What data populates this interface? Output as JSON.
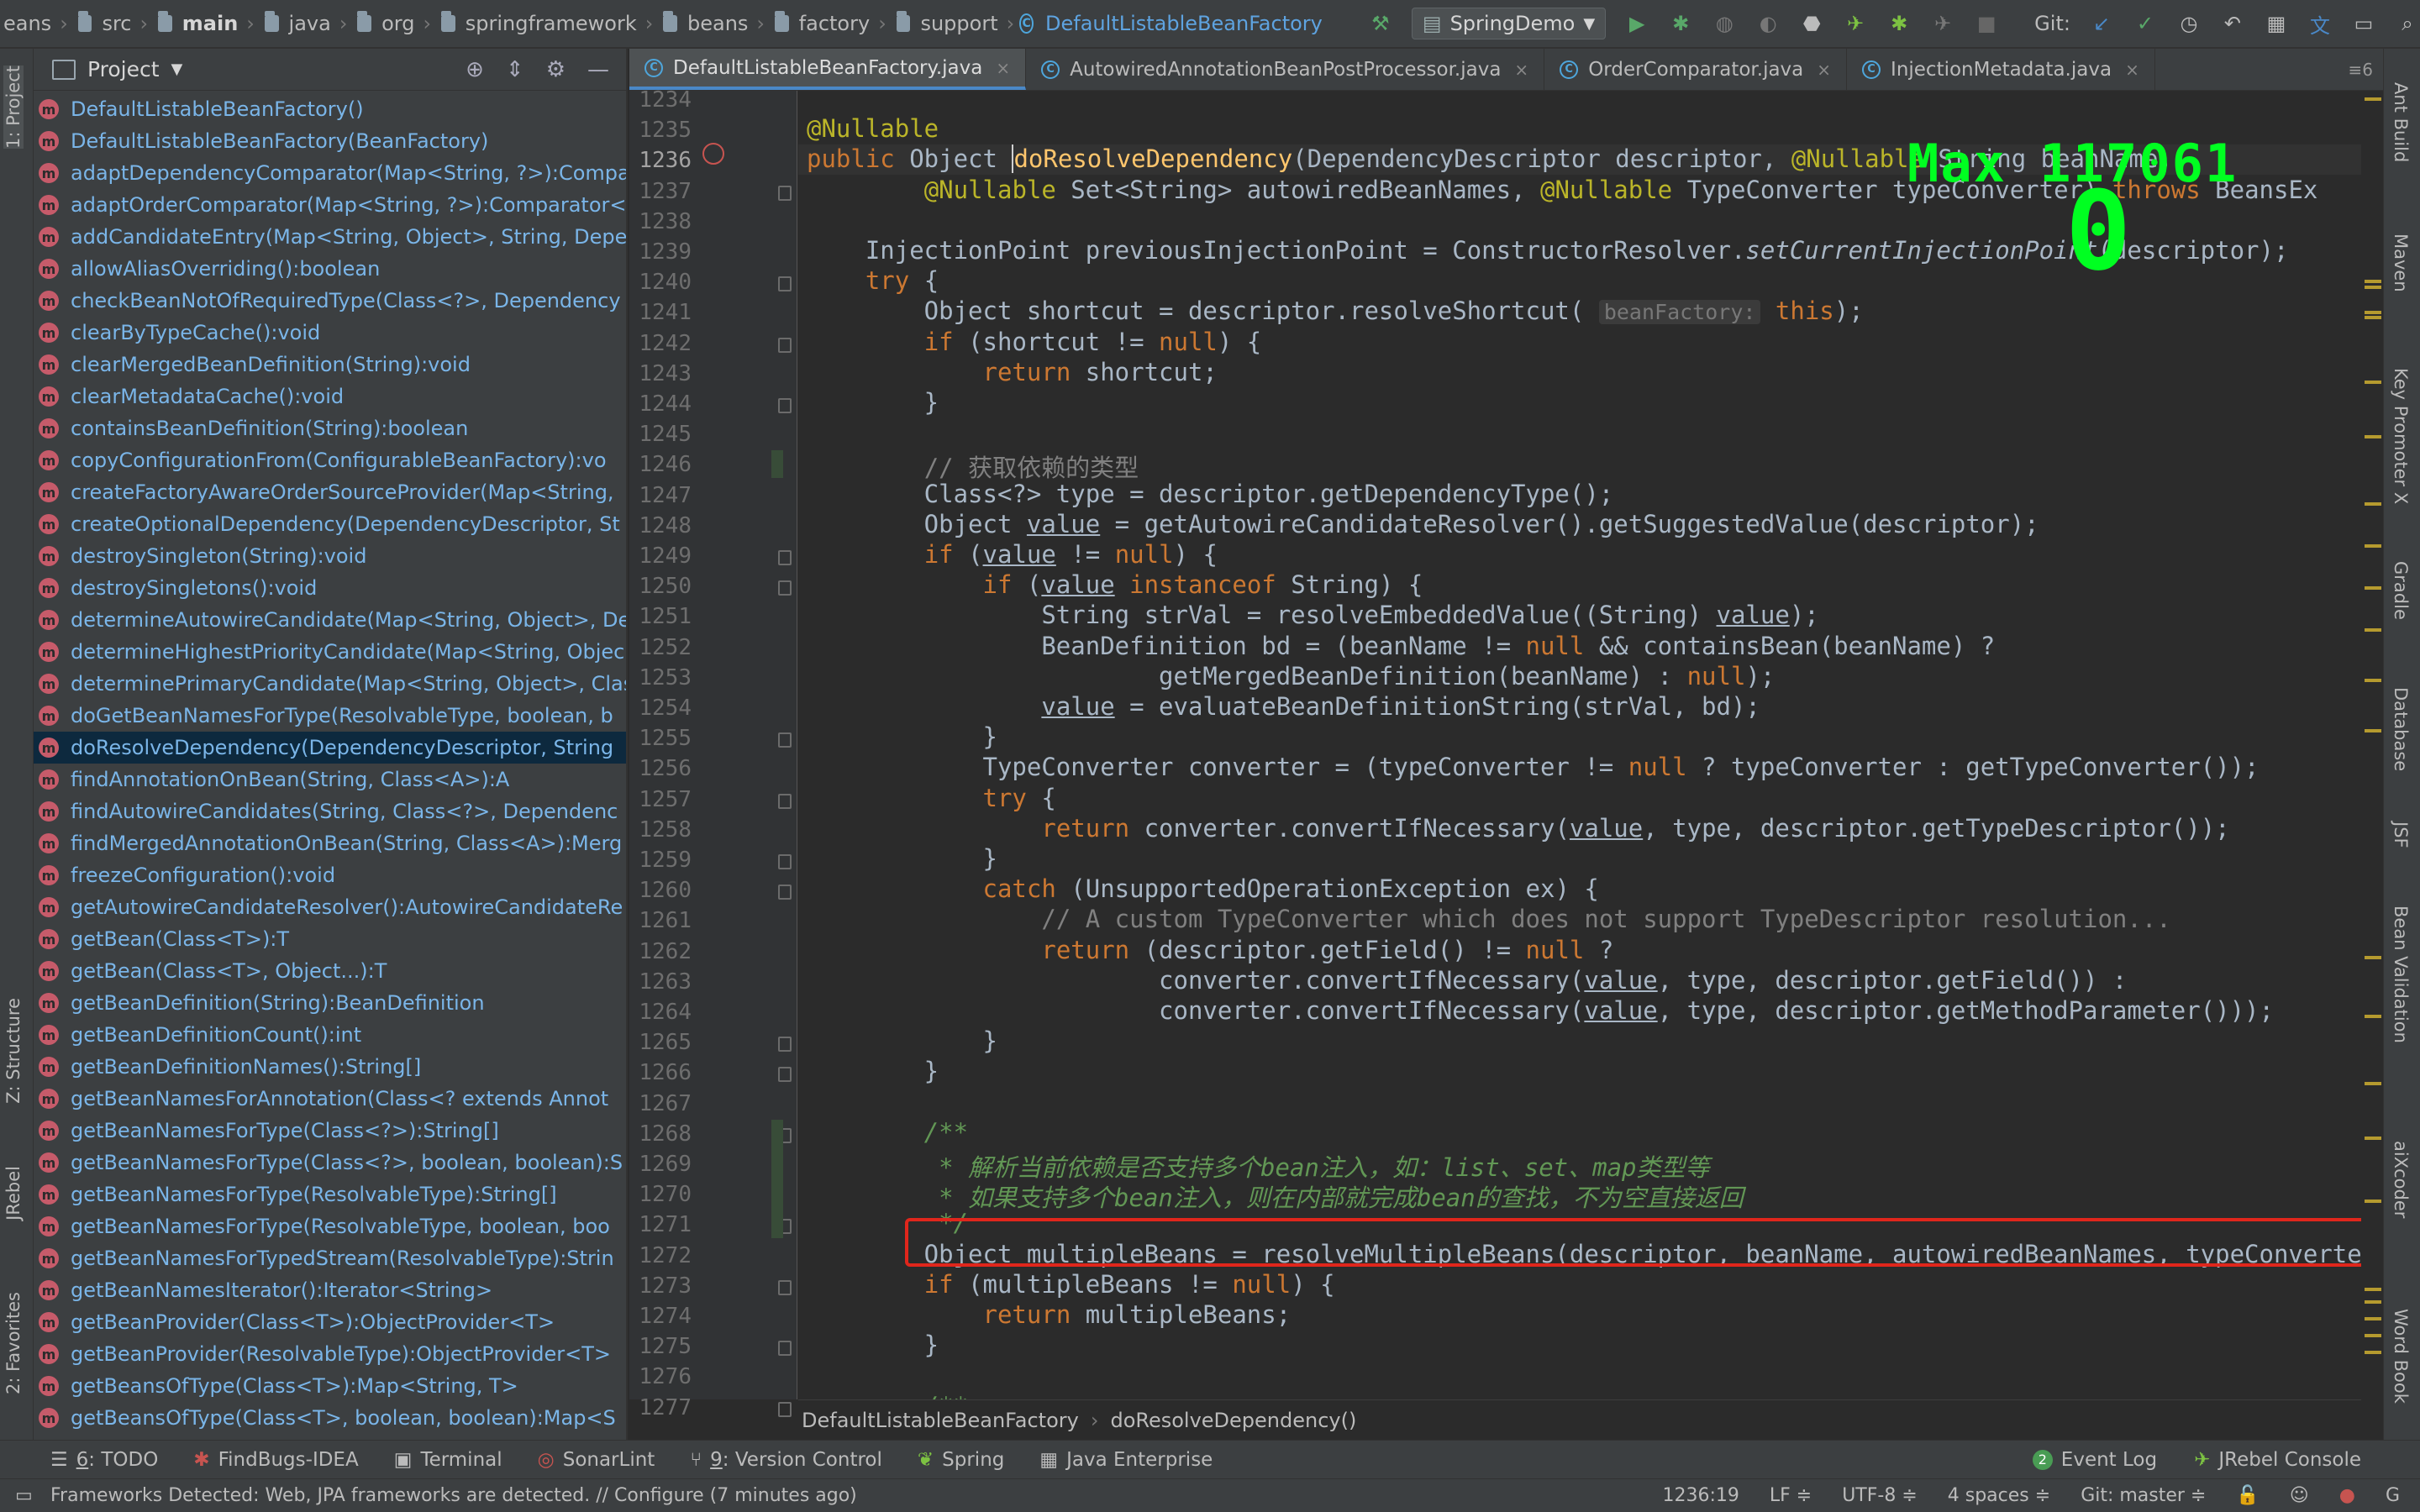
{
  "breadcrumb": [
    "eans",
    "src",
    "main",
    "java",
    "org",
    "springframework",
    "beans",
    "factory",
    "support"
  ],
  "breadcrumb_class": "DefaultListableBeanFactory",
  "run_config": "SpringDemo",
  "git_label": "Git:",
  "project_panel": {
    "title": "Project",
    "methods": [
      "DefaultListableBeanFactory()",
      "DefaultListableBeanFactory(BeanFactory)",
      "adaptDependencyComparator(Map<String, ?>):Compa",
      "adaptOrderComparator(Map<String, ?>):Comparator<",
      "addCandidateEntry(Map<String, Object>, String, Depe",
      "allowAliasOverriding():boolean",
      "checkBeanNotOfRequiredType(Class<?>, Dependency",
      "clearByTypeCache():void",
      "clearMergedBeanDefinition(String):void",
      "clearMetadataCache():void",
      "containsBeanDefinition(String):boolean",
      "copyConfigurationFrom(ConfigurableBeanFactory):vo",
      "createFactoryAwareOrderSourceProvider(Map<String,",
      "createOptionalDependency(DependencyDescriptor, St",
      "destroySingleton(String):void",
      "destroySingletons():void",
      "determineAutowireCandidate(Map<String, Object>, De",
      "determineHighestPriorityCandidate(Map<String, Objec",
      "determinePrimaryCandidate(Map<String, Object>, Clas",
      "doGetBeanNamesForType(ResolvableType, boolean, b",
      "doResolveDependency(DependencyDescriptor, String",
      "findAnnotationOnBean(String, Class<A>):A",
      "findAutowireCandidates(String, Class<?>, Dependenc",
      "findMergedAnnotationOnBean(String, Class<A>):Merg",
      "freezeConfiguration():void",
      "getAutowireCandidateResolver():AutowireCandidateRe",
      "getBean(Class<T>):T",
      "getBean(Class<T>, Object...):T",
      "getBeanDefinition(String):BeanDefinition",
      "getBeanDefinitionCount():int",
      "getBeanDefinitionNames():String[]",
      "getBeanNamesForAnnotation(Class<? extends Annot",
      "getBeanNamesForType(Class<?>):String[]",
      "getBeanNamesForType(Class<?>, boolean, boolean):S",
      "getBeanNamesForType(ResolvableType):String[]",
      "getBeanNamesForType(ResolvableType, boolean, boo",
      "getBeanNamesForTypedStream(ResolvableType):Strin",
      "getBeanNamesIterator():Iterator<String>",
      "getBeanProvider(Class<T>):ObjectProvider<T>",
      "getBeanProvider(ResolvableType):ObjectProvider<T>",
      "getBeansOfType(Class<T>):Map<String, T>",
      "getBeansOfType(Class<T>, boolean, boolean):Map<S"
    ],
    "selected_index": 20
  },
  "tabs": [
    {
      "label": "DefaultListableBeanFactory.java",
      "active": true
    },
    {
      "label": "AutowiredAnnotationBeanPostProcessor.java",
      "active": false
    },
    {
      "label": "OrderComparator.java",
      "active": false
    },
    {
      "label": "InjectionMetadata.java",
      "active": false
    }
  ],
  "tab_overflow_count": "6",
  "editor": {
    "current_line": 1236,
    "lines": [
      {
        "n": 1234,
        "h": ""
      },
      {
        "n": 1235,
        "h": "<span class=\"an\">@Nullable</span>"
      },
      {
        "n": 1236,
        "h": "<span class=\"kw\">public</span> Object <span class=\"caret\"></span><span class=\"fn\">doResolveDependency</span>(DependencyDescriptor descriptor, <span class=\"an\">@Nullable</span> String beanName,"
      },
      {
        "n": 1237,
        "h": "        <span class=\"an\">@Nullable</span> Set&lt;String&gt; autowiredBeanNames, <span class=\"an\">@Nullable</span> TypeConverter typeConverter) <span class=\"kw\">throws</span> BeansEx"
      },
      {
        "n": 1238,
        "h": ""
      },
      {
        "n": 1239,
        "h": "    InjectionPoint previousInjectionPoint = ConstructorResolver.<span class=\"it\">setCurrentInjectionPoint</span>(descriptor);"
      },
      {
        "n": 1240,
        "h": "    <span class=\"kw\">try</span> {"
      },
      {
        "n": 1241,
        "h": "        Object shortcut = descriptor.resolveShortcut( <span class=\"hint\">beanFactory:</span> <span class=\"kw\">this</span>);"
      },
      {
        "n": 1242,
        "h": "        <span class=\"kw\">if</span> (shortcut != <span class=\"kw\">null</span>) {"
      },
      {
        "n": 1243,
        "h": "            <span class=\"kw\">return</span> shortcut;"
      },
      {
        "n": 1244,
        "h": "        }"
      },
      {
        "n": 1245,
        "h": ""
      },
      {
        "n": 1246,
        "h": "        <span class=\"cm\">// 获取依赖的类型</span>"
      },
      {
        "n": 1247,
        "h": "        Class&lt;?&gt; type = descriptor.getDependencyType();"
      },
      {
        "n": 1248,
        "h": "        Object <span class=\"ul\">value</span> = getAutowireCandidateResolver().getSuggestedValue(descriptor);"
      },
      {
        "n": 1249,
        "h": "        <span class=\"kw\">if</span> (<span class=\"ul\">value</span> != <span class=\"kw\">null</span>) {"
      },
      {
        "n": 1250,
        "h": "            <span class=\"kw\">if</span> (<span class=\"ul\">value</span> <span class=\"kw\">instanceof</span> String) {"
      },
      {
        "n": 1251,
        "h": "                String strVal = resolveEmbeddedValue((String) <span class=\"ul\">value</span>);"
      },
      {
        "n": 1252,
        "h": "                BeanDefinition bd = (beanName != <span class=\"kw\">null</span> &amp;&amp; containsBean(beanName) ?"
      },
      {
        "n": 1253,
        "h": "                        getMergedBeanDefinition(beanName) : <span class=\"kw\">null</span>);"
      },
      {
        "n": 1254,
        "h": "                <span class=\"ul\">value</span> = evaluateBeanDefinitionString(strVal, bd);"
      },
      {
        "n": 1255,
        "h": "            }"
      },
      {
        "n": 1256,
        "h": "            TypeConverter converter = (typeConverter != <span class=\"kw\">null</span> ? typeConverter : getTypeConverter());"
      },
      {
        "n": 1257,
        "h": "            <span class=\"kw\">try</span> {"
      },
      {
        "n": 1258,
        "h": "                <span class=\"kw\">return</span> converter.convertIfNecessary(<span class=\"ul\">value</span>, type, descriptor.getTypeDescriptor());"
      },
      {
        "n": 1259,
        "h": "            }"
      },
      {
        "n": 1260,
        "h": "            <span class=\"kw\">catch</span> (UnsupportedOperationException ex) {"
      },
      {
        "n": 1261,
        "h": "                <span class=\"cm\">// A custom TypeConverter which does not support TypeDescriptor resolution...</span>"
      },
      {
        "n": 1262,
        "h": "                <span class=\"kw\">return</span> (descriptor.getField() != <span class=\"kw\">null</span> ?"
      },
      {
        "n": 1263,
        "h": "                        converter.convertIfNecessary(<span class=\"ul\">value</span>, type, descriptor.getField()) :"
      },
      {
        "n": 1264,
        "h": "                        converter.convertIfNecessary(<span class=\"ul\">value</span>, type, descriptor.getMethodParameter()));"
      },
      {
        "n": 1265,
        "h": "            }"
      },
      {
        "n": 1266,
        "h": "        }"
      },
      {
        "n": 1267,
        "h": ""
      },
      {
        "n": 1268,
        "h": "        <span class=\"doc\">/**</span>"
      },
      {
        "n": 1269,
        "h": "<span class=\"doc\">         * 解析当前依赖是否支持多个bean注入，如：list、set、map类型等</span>"
      },
      {
        "n": 1270,
        "h": "<span class=\"doc\">         * 如果支持多个bean注入，则在内部就完成bean的查找，不为空直接返回</span>"
      },
      {
        "n": 1271,
        "h": "<span class=\"doc\">         */</span>"
      },
      {
        "n": 1272,
        "h": "        Object multipleBeans = resolveMultipleBeans(descriptor, beanName, autowiredBeanNames, typeConverter);"
      },
      {
        "n": 1273,
        "h": "        <span class=\"kw\">if</span> (multipleBeans != <span class=\"kw\">null</span>) {"
      },
      {
        "n": 1274,
        "h": "            <span class=\"kw\">return</span> multipleBeans;"
      },
      {
        "n": 1275,
        "h": "        }"
      },
      {
        "n": 1276,
        "h": ""
      },
      {
        "n": 1277,
        "h": "        <span class=\"doc\">/**</span>"
      }
    ]
  },
  "overlay": {
    "max_label": "Max 117061",
    "zero_label": "0"
  },
  "editor_breadcrumb": [
    "DefaultListableBeanFactory",
    "doResolveDependency()"
  ],
  "right_tools": [
    "Ant Build",
    "Maven",
    "Key Promoter X",
    "Gradle",
    "Database",
    "JSF",
    "Bean Validation",
    "aiXcoder",
    "Word Book"
  ],
  "left_tools": [
    "1: Project",
    "Z: Structure",
    "JRebel",
    "2: Favorites"
  ],
  "bottom_tools": {
    "todo": {
      "num": "6",
      "label": ": TODO"
    },
    "findbugs": "FindBugs-IDEA",
    "terminal": "Terminal",
    "sonarlint": "SonarLint",
    "vcs": {
      "num": "9",
      "label": ": Version Control"
    },
    "spring": "Spring",
    "javaee": "Java Enterprise",
    "event_log": {
      "count": "2",
      "label": "Event Log"
    },
    "jrebel": "JRebel Console"
  },
  "status": {
    "message": "Frameworks Detected: Web, JPA frameworks are detected. // Configure (7 minutes ago)",
    "position": "1236:19",
    "line_sep": "LF ≑",
    "encoding": "UTF-8 ≑",
    "indent": "4 spaces ≑",
    "git_branch": "Git: master ≑"
  },
  "colors": {
    "accent": "#4a88c7",
    "highlight_box": "#e0261c",
    "overlay": "#00ff21"
  }
}
